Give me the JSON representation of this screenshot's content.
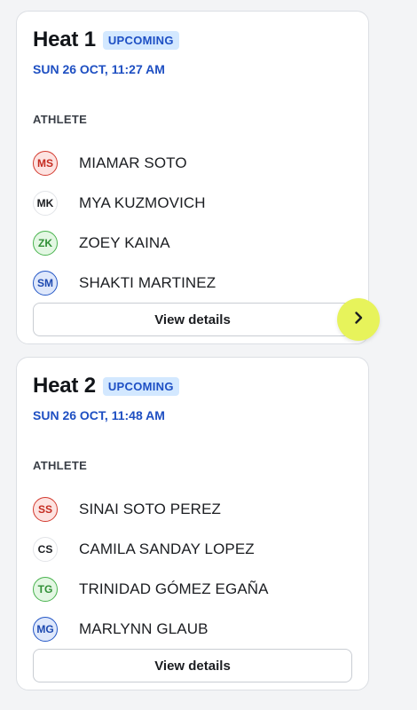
{
  "heats": [
    {
      "title": "Heat 1",
      "status": "UPCOMING",
      "date": "SUN 26 OCT, 11:27 AM",
      "column_label": "ATHLETE",
      "athletes": [
        {
          "initials": "MS",
          "name": "MIAMAR SOTO",
          "color": "red"
        },
        {
          "initials": "MK",
          "name": "MYA KUZMOVICH",
          "color": "white"
        },
        {
          "initials": "ZK",
          "name": "ZOEY KAINA",
          "color": "green"
        },
        {
          "initials": "SM",
          "name": "SHAKTI MARTINEZ",
          "color": "blue"
        }
      ],
      "button_label": "View details"
    },
    {
      "title": "Heat 2",
      "status": "UPCOMING",
      "date": "SUN 26 OCT, 11:48 AM",
      "column_label": "ATHLETE",
      "athletes": [
        {
          "initials": "SS",
          "name": "SINAI SOTO PEREZ",
          "color": "red"
        },
        {
          "initials": "CS",
          "name": "CAMILA SANDAY LOPEZ",
          "color": "white"
        },
        {
          "initials": "TG",
          "name": "TRINIDAD GÓMEZ EGAÑA",
          "color": "green"
        },
        {
          "initials": "MG",
          "name": "MARLYNN GLAUB",
          "color": "blue"
        }
      ],
      "button_label": "View details"
    }
  ],
  "colors": {
    "badge_bg": "#d3e8ff",
    "badge_text": "#1d4fc4",
    "date_text": "#1e4fc2",
    "next_button_bg": "#e7f35b"
  },
  "next_button_icon": "chevron-right-icon"
}
